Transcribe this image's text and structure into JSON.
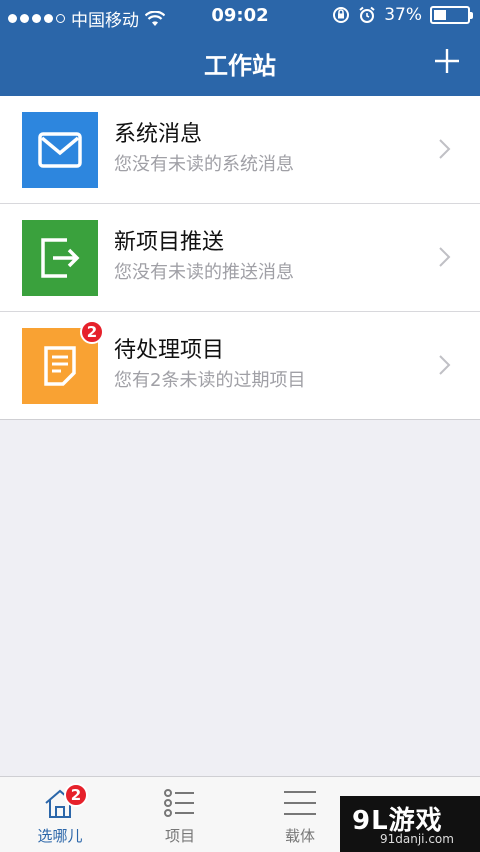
{
  "status_bar": {
    "carrier": "中国移动",
    "time": "09:02",
    "battery": "37%",
    "battery_level": 0.37,
    "icons": [
      "signal-dots",
      "wifi-icon",
      "rotation-lock-icon",
      "alarm-icon",
      "battery-icon"
    ]
  },
  "nav": {
    "title": "工作站",
    "right_icon": "plus-icon"
  },
  "list": {
    "items": [
      {
        "title": "系统消息",
        "subtitle": "您没有未读的系统消息",
        "icon": "mail-icon",
        "color": "#2d86de",
        "badge": ""
      },
      {
        "title": "新项目推送",
        "subtitle": "您没有未读的推送消息",
        "icon": "export-icon",
        "color": "#3aa13d",
        "badge": ""
      },
      {
        "title": "待处理项目",
        "subtitle": "您有2条未读的过期项目",
        "icon": "document-icon",
        "color": "#f9a233",
        "badge": "2"
      }
    ]
  },
  "tabbar": {
    "tabs": [
      {
        "label": "选哪儿",
        "icon": "home-icon",
        "badge": "2",
        "active": true
      },
      {
        "label": "项目",
        "icon": "list-icon",
        "badge": "",
        "active": false
      },
      {
        "label": "载体",
        "icon": "menu-icon",
        "badge": "",
        "active": false
      }
    ]
  },
  "watermark": {
    "brand": "9L游戏",
    "domain": "91danji.com"
  },
  "colors": {
    "primary": "#2b66a9",
    "badge": "#e6212b",
    "background": "#efeff4"
  }
}
